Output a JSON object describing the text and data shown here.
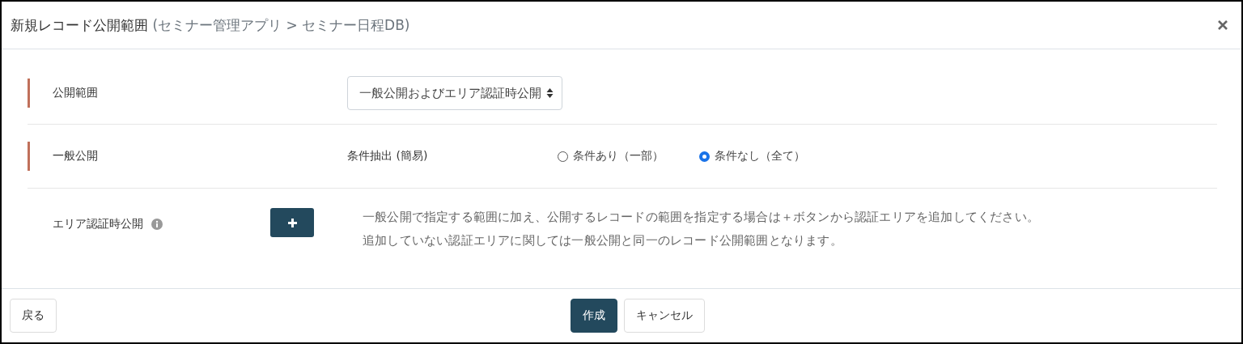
{
  "dialog": {
    "title": "新規レコード公開範囲",
    "subtitle": "(セミナー管理アプリ > セミナー日程DB)"
  },
  "scope": {
    "label": "公開範囲",
    "accent": true,
    "select_value": "一般公開およびエリア認証時公開"
  },
  "public": {
    "label": "一般公開",
    "accent": true,
    "field_label": "条件抽出 (簡易)",
    "options": [
      {
        "label": "条件あり（一部）",
        "selected": false
      },
      {
        "label": "条件なし（全て）",
        "selected": true
      }
    ]
  },
  "area": {
    "label": "エリア認証時公開",
    "accent": false,
    "description": [
      "一般公開で指定する範囲に加え、公開するレコードの範囲を指定する場合は＋ボタンから認証エリアを追加してください。",
      "追加していない認証エリアに関しては一般公開と同一のレコード公開範囲となります。"
    ]
  },
  "footer": {
    "back": "戻る",
    "create": "作成",
    "cancel": "キャンセル"
  }
}
